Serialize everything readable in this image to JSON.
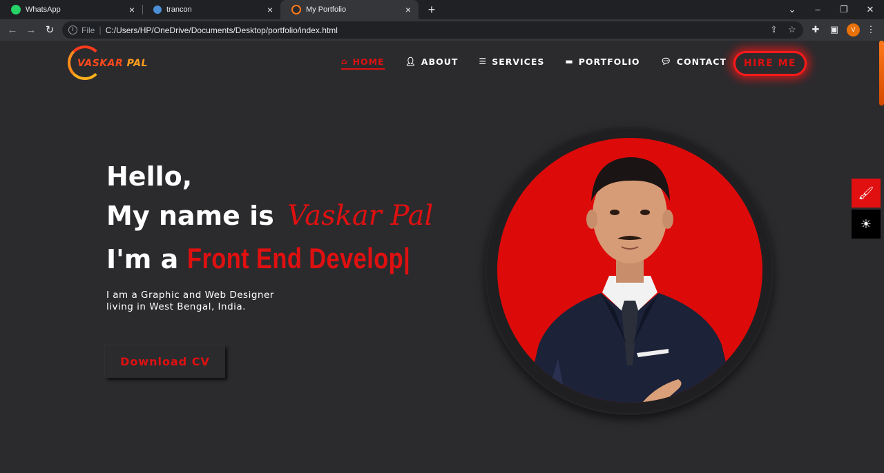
{
  "browser": {
    "tabs": [
      {
        "title": "WhatsApp",
        "icon": "whatsapp-icon",
        "active": false
      },
      {
        "title": "trancon",
        "icon": "globe-icon",
        "active": false
      },
      {
        "title": "My Portfolio",
        "icon": "portfolio-favicon-icon",
        "active": true
      }
    ],
    "address": {
      "scheme": "File",
      "url": "C:/Users/HP/OneDrive/Documents/Desktop/portfolio/index.html"
    },
    "profile_initial": "V"
  },
  "site": {
    "logo": {
      "first": "VASKAR",
      "second": "PAL"
    },
    "nav": [
      {
        "label": "HOME",
        "icon": "home-icon",
        "active": true
      },
      {
        "label": "ABOUT",
        "icon": "user-icon",
        "active": false
      },
      {
        "label": "SERVICES",
        "icon": "list-icon",
        "active": false
      },
      {
        "label": "PORTFOLIO",
        "icon": "briefcase-icon",
        "active": false
      },
      {
        "label": "CONTACT",
        "icon": "comments-icon",
        "active": false
      }
    ],
    "hire_label": "HIRE ME",
    "hero": {
      "greeting": "Hello,",
      "name_prefix": "My name is",
      "name": "Vaskar Pal",
      "role_prefix": "I'm a",
      "role_typed": "Front End Develop",
      "caret": "|",
      "desc_line1": "I am a Graphic and Web Designer",
      "desc_line2": "living in West Bengal, India.",
      "cv_label": "Download CV"
    },
    "colors": {
      "accent": "#e01010",
      "background": "#2b2b2e",
      "logo_orange": "#ff9d1c"
    }
  }
}
